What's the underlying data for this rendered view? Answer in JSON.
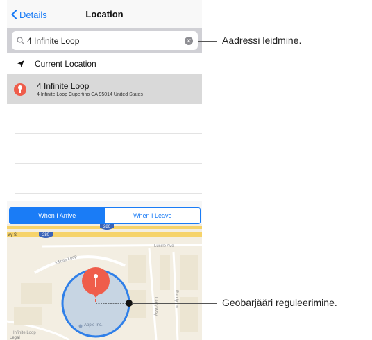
{
  "nav": {
    "back_label": "Details",
    "title": "Location"
  },
  "search": {
    "value": "4 Infinite Loop"
  },
  "current_location": {
    "label": "Current Location"
  },
  "result": {
    "title": "4 Infinite Loop",
    "subtitle": "4 Infinite Loop Cupertino CA 95014 United States"
  },
  "segment": {
    "arrive_label": "When I Arrive",
    "leave_label": "When I Leave",
    "selected": "When I Arrive"
  },
  "map": {
    "highway_shield_top": "280",
    "highway_shield_left": "280",
    "road_prefix": "wy S",
    "street_lucille": "Lucille Ave",
    "street_infinite": "Infinite Loop",
    "street_larry": "Larry Way",
    "street_randy": "Randy Ln",
    "poi_apple": "Apple Inc.",
    "street_infinite_bottom": "Infinite Loop",
    "legal": "Legal",
    "colors": {
      "water": "#f4ecd8",
      "highway": "#f6d36a",
      "geofence": "#2f7fe8",
      "pin": "#ef5d4b"
    }
  },
  "callouts": {
    "address": "Aadressi leidmine.",
    "geofence": "Geobarjääri reguleerimine."
  }
}
